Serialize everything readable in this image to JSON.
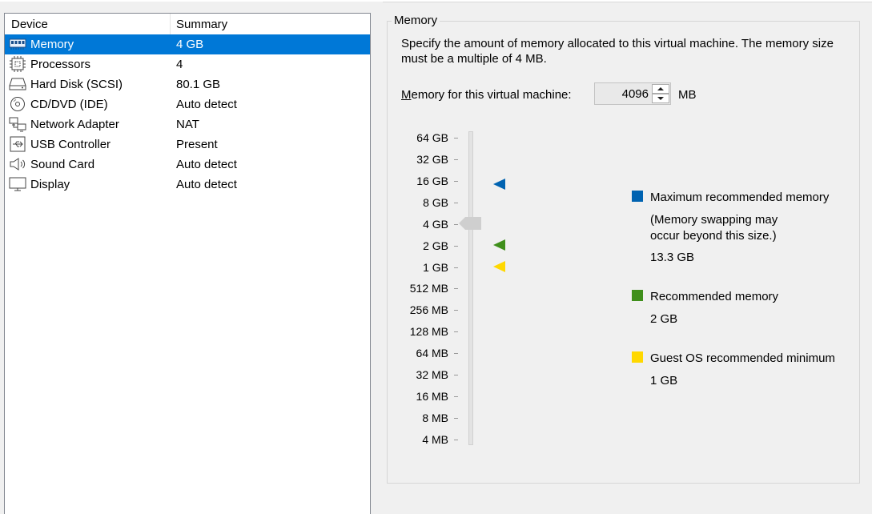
{
  "device_list": {
    "columns": [
      "Device",
      "Summary"
    ],
    "rows": [
      {
        "device": "Memory",
        "summary": "4 GB",
        "icon": "memory-icon",
        "selected": true
      },
      {
        "device": "Processors",
        "summary": "4",
        "icon": "processor-icon"
      },
      {
        "device": "Hard Disk (SCSI)",
        "summary": "80.1 GB",
        "icon": "hard-disk-icon"
      },
      {
        "device": "CD/DVD (IDE)",
        "summary": "Auto detect",
        "icon": "cd-dvd-icon"
      },
      {
        "device": "Network Adapter",
        "summary": "NAT",
        "icon": "network-adapter-icon"
      },
      {
        "device": "USB Controller",
        "summary": "Present",
        "icon": "usb-icon"
      },
      {
        "device": "Sound Card",
        "summary": "Auto detect",
        "icon": "speaker-icon"
      },
      {
        "device": "Display",
        "summary": "Auto detect",
        "icon": "monitor-icon"
      }
    ]
  },
  "memory": {
    "group_title": "Memory",
    "description": "Specify the amount of memory allocated to this virtual machine. The memory size must be a multiple of 4 MB.",
    "field_label_accel": "M",
    "field_label_rest": "emory for this virtual machine:",
    "value": "4096",
    "unit": "MB",
    "scale_labels": [
      "64 GB",
      "32 GB",
      "16 GB",
      "8 GB",
      "4 GB",
      "2 GB",
      "1 GB",
      "512 MB",
      "256 MB",
      "128 MB",
      "64 MB",
      "32 MB",
      "16 MB",
      "8 MB",
      "4 MB"
    ],
    "slider_value": "4 GB",
    "markers": {
      "maximum": "16 GB",
      "recommended": "2 GB",
      "guest_minimum": "1 GB"
    },
    "legend": {
      "max_label": "Maximum recommended memory",
      "max_note_line1": "(Memory swapping may",
      "max_note_line2": "occur beyond this size.)",
      "max_value": "13.3 GB",
      "rec_label": "Recommended memory",
      "rec_value": "2 GB",
      "min_label": "Guest OS recommended minimum",
      "min_value": "1 GB"
    },
    "colors": {
      "maximum": "#0063b1",
      "recommended": "#3f8f1b",
      "guest_minimum": "#ffd800",
      "selection": "#0078d7"
    }
  }
}
